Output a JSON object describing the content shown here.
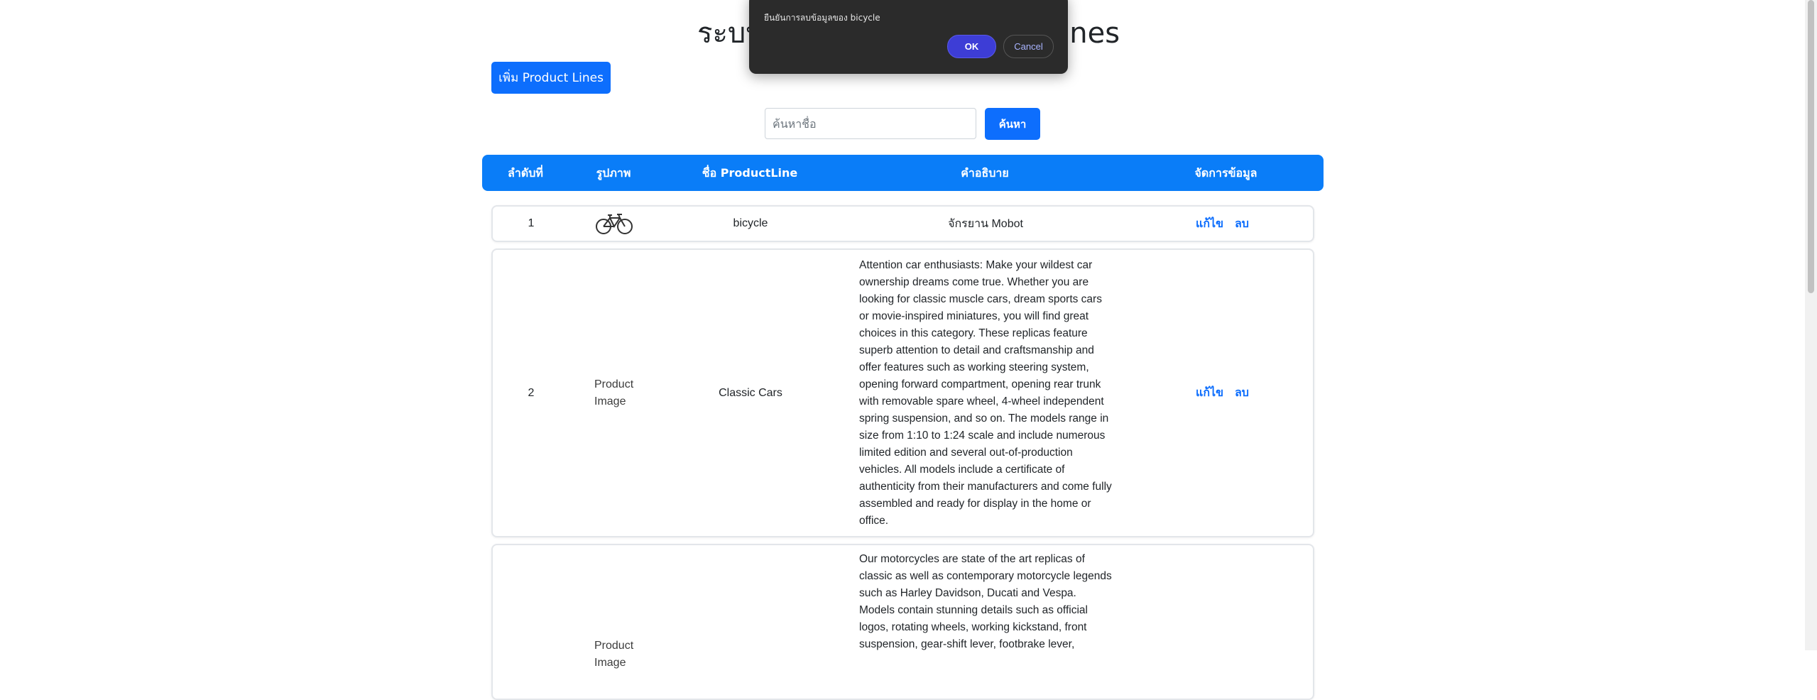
{
  "page": {
    "title": "ระบบจัดการข้อมูล Product Lines",
    "add_button": "เพิ่ม Product Lines",
    "search_placeholder": "ค้นหาชื่อ",
    "search_button": "ค้นหา"
  },
  "table": {
    "headers": [
      "ลำดับที่",
      "รูปภาพ",
      "ชื่อ ProductLine",
      "คำอธิบาย",
      "จัดการข้อมูล"
    ],
    "edit_label": "แก้ไข",
    "delete_label": "ลบ",
    "broken_image_alt": "Product Image",
    "rows": [
      {
        "index": "1",
        "image": "bicycle-icon",
        "name": "bicycle",
        "description": "จักรยาน Mobot"
      },
      {
        "index": "2",
        "image": "broken-image",
        "name": "Classic Cars",
        "description": "Attention car enthusiasts: Make your wildest car ownership dreams come true. Whether you are looking for classic muscle cars, dream sports cars or movie-inspired miniatures, you will find great choices in this category. These replicas feature superb attention to detail and craftsmanship and offer features such as working steering system, opening forward compartment, opening rear trunk with removable spare wheel, 4-wheel independent spring suspension, and so on. The models range in size from 1:10 to 1:24 scale and include numerous limited edition and several out-of-production vehicles. All models include a certificate of authenticity from their manufacturers and come fully assembled and ready for display in the home or office."
      },
      {
        "index": "",
        "image": "broken-image",
        "name": "",
        "description": "Our motorcycles are state of the art replicas of classic as well as contemporary motorcycle legends such as Harley Davidson, Ducati and Vespa. Models contain stunning details such as official logos, rotating wheels, working kickstand, front suspension, gear-shift lever, footbrake lever,"
      }
    ]
  },
  "dialog": {
    "message": "ยืนยันการลบข้อมูลของ bicycle",
    "ok_label": "OK",
    "cancel_label": "Cancel"
  },
  "colors": {
    "primary": "#0d6efd",
    "header": "#0a7df8",
    "dialog_bg": "#2b2b2b",
    "ok": "#3d3dd6"
  }
}
